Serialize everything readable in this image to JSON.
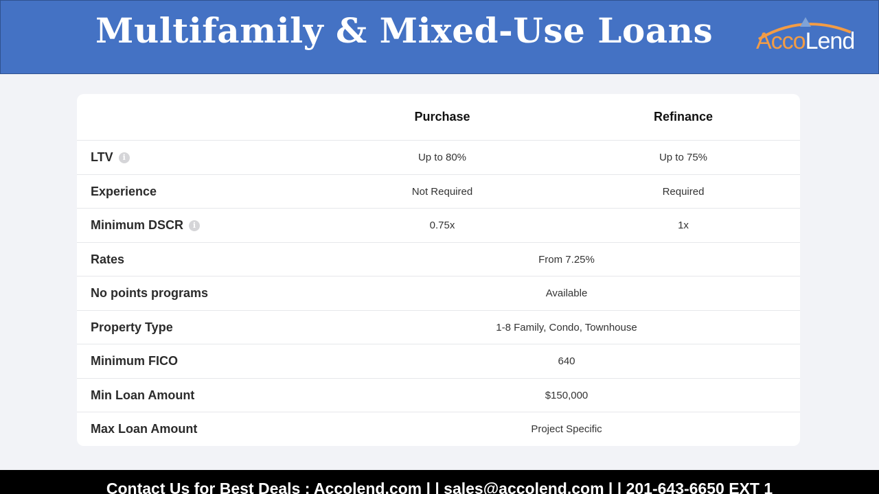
{
  "header": {
    "title": "Multifamily & Mixed-Use Loans",
    "logo": {
      "part1": "Acco",
      "part2": "Lend",
      "icon": "house-roof-icon"
    }
  },
  "table": {
    "columns": [
      "Purchase",
      "Refinance"
    ],
    "rows": [
      {
        "label": "LTV",
        "info": true,
        "purchase": "Up to 80%",
        "refinance": "Up to 75%"
      },
      {
        "label": "Experience",
        "info": false,
        "purchase": "Not Required",
        "refinance": "Required"
      },
      {
        "label": "Minimum DSCR",
        "info": true,
        "purchase": "0.75x",
        "refinance": "1x"
      },
      {
        "label": "Rates",
        "value": "From 7.25%"
      },
      {
        "label": "No points programs",
        "value": "Available"
      },
      {
        "label": "Property Type",
        "value": "1-8 Family, Condo, Townhouse"
      },
      {
        "label": "Minimum FICO",
        "value": "640"
      },
      {
        "label": "Min Loan Amount",
        "value": "$150,000"
      },
      {
        "label": "Max Loan Amount",
        "value": "Project Specific"
      }
    ],
    "info_icon_glyph": "i"
  },
  "footer": {
    "text": "Contact Us for Best Deals : Accolend.com | | sales@accolend.com | | 201-643-6650 EXT 1"
  },
  "colors": {
    "header_bg": "#4472c4",
    "logo_orange": "#f39c45",
    "logo_blue": "#7fa3d8",
    "footer_bg": "#000000",
    "page_bg": "#f2f3f7"
  }
}
